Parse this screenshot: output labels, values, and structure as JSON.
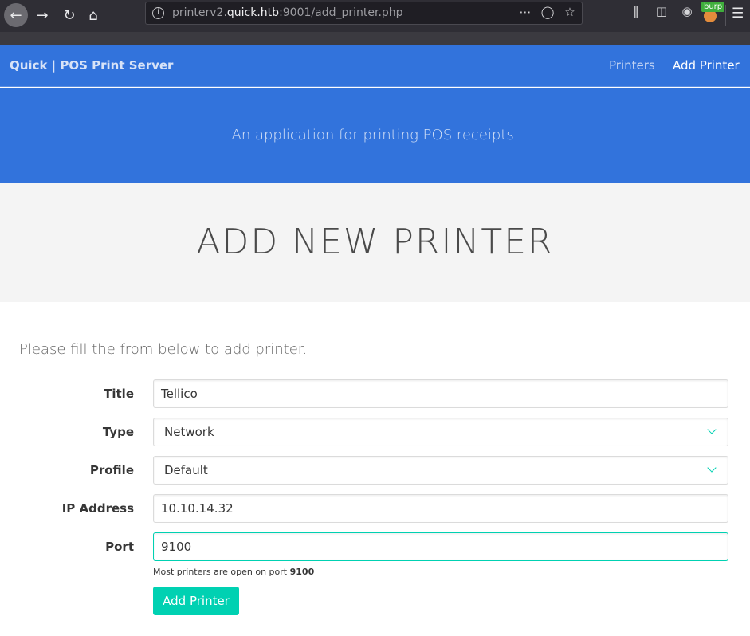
{
  "browser": {
    "url_prefix": "printerv2.",
    "url_host": "quick.htb",
    "url_suffix": ":9001/add_printer.php",
    "burp_label": "burp",
    "icons": [
      "back-icon",
      "forward-icon",
      "reload-icon",
      "home-icon",
      "info-icon",
      "more-icon",
      "pocket-icon",
      "bookmark-star-icon",
      "library-icon",
      "sidebar-icon",
      "account-icon",
      "burp-extension-icon",
      "menu-icon"
    ]
  },
  "navbar": {
    "brand": "Quick | POS Print Server",
    "links": [
      {
        "label": "Printers"
      },
      {
        "label": "Add Printer"
      }
    ]
  },
  "hero": {
    "subtitle": "An application for printing POS receipts."
  },
  "page": {
    "title": "ADD NEW PRINTER",
    "intro": "Please fill the from below to add printer."
  },
  "form": {
    "title": {
      "label": "Title",
      "value": "Tellico"
    },
    "type": {
      "label": "Type",
      "value": "Network"
    },
    "profile": {
      "label": "Profile",
      "value": "Default"
    },
    "ip": {
      "label": "IP Address",
      "value": "10.10.14.32"
    },
    "port": {
      "label": "Port",
      "value": "9100"
    },
    "help_text": "Most printers are open on port ",
    "help_port": "9100",
    "submit_label": "Add Printer"
  },
  "colors": {
    "primary": "#3273dc",
    "accent": "#00d1b2",
    "title_band": "#f4f4f4"
  }
}
